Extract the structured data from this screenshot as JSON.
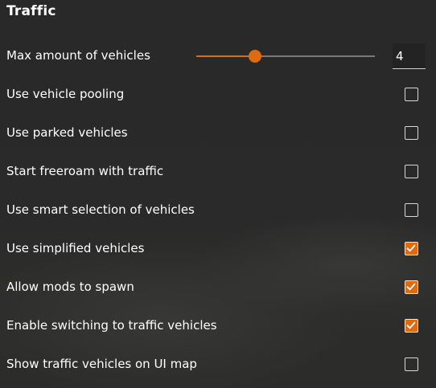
{
  "section": {
    "title": "Traffic"
  },
  "max_vehicles": {
    "label": "Max amount of vehicles",
    "value": "4",
    "slider_fraction": 0.33
  },
  "options": [
    {
      "label": "Use vehicle pooling",
      "checked": false
    },
    {
      "label": "Use parked vehicles",
      "checked": false
    },
    {
      "label": "Start freeroam with traffic",
      "checked": false
    },
    {
      "label": "Use smart selection of vehicles",
      "checked": false
    },
    {
      "label": "Use simplified vehicles",
      "checked": true
    },
    {
      "label": "Allow mods to spawn",
      "checked": true
    },
    {
      "label": "Enable switching to traffic vehicles",
      "checked": true
    },
    {
      "label": "Show traffic vehicles on UI map",
      "checked": false
    }
  ],
  "colors": {
    "accent": "#e06a10",
    "text": "#ffffff"
  }
}
